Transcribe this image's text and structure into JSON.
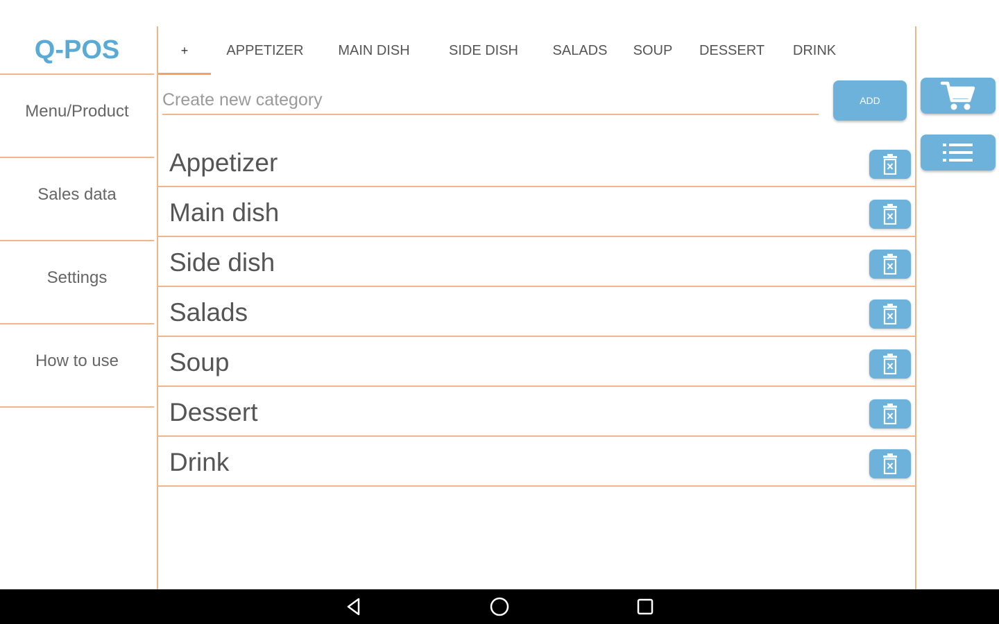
{
  "app": {
    "title": "Q-POS"
  },
  "sidebar": {
    "items": [
      {
        "label": "Menu/Product"
      },
      {
        "label": "Sales data"
      },
      {
        "label": "Settings"
      },
      {
        "label": "How to use"
      }
    ]
  },
  "tabs": {
    "add_symbol": "+",
    "items": [
      {
        "label": "APPETIZER"
      },
      {
        "label": "MAIN DISH"
      },
      {
        "label": "SIDE DISH"
      },
      {
        "label": "SALADS"
      },
      {
        "label": "SOUP"
      },
      {
        "label": "DESSERT"
      },
      {
        "label": "DRINK"
      }
    ]
  },
  "new_category": {
    "value": "",
    "placeholder": "Create new category",
    "add_label": "ADD"
  },
  "categories": [
    {
      "name": "Appetizer"
    },
    {
      "name": "Main dish"
    },
    {
      "name": "Side dish"
    },
    {
      "name": "Salads"
    },
    {
      "name": "Soup"
    },
    {
      "name": "Dessert"
    },
    {
      "name": "Drink"
    }
  ],
  "icons": {
    "delete": "trash-icon",
    "cart": "cart-icon",
    "list": "list-icon",
    "back": "back-icon",
    "home": "home-icon",
    "recents": "recents-icon"
  },
  "colors": {
    "accent": "#6db2db",
    "logo": "#5aaad6",
    "divider": "#f2b58a",
    "navbar": "#000000"
  }
}
